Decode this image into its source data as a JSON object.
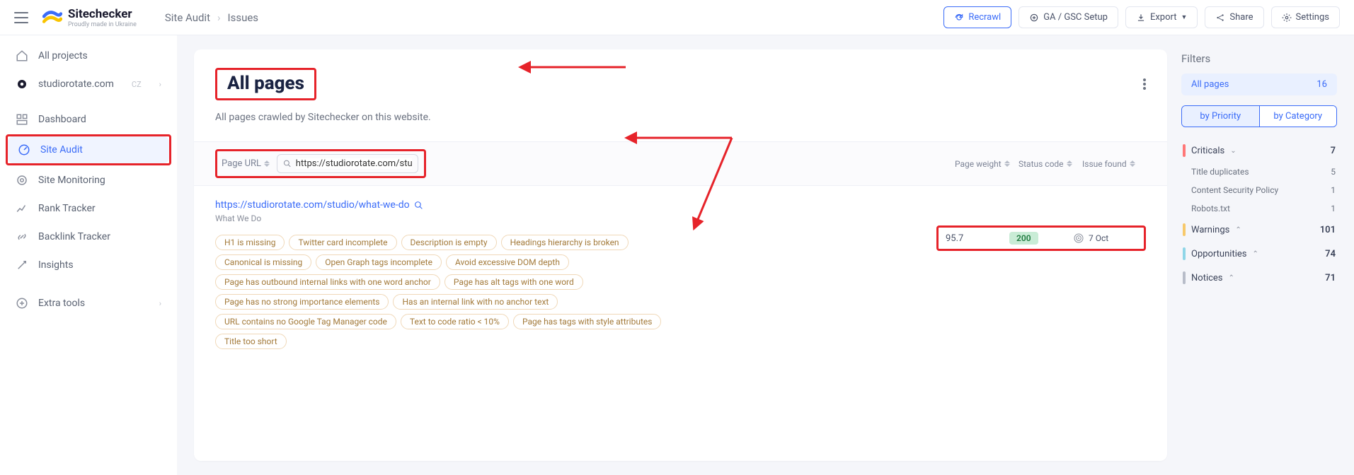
{
  "brand": {
    "title": "Sitechecker",
    "tagline": "Proudly made in Ukraine"
  },
  "breadcrumb": {
    "parent": "Site Audit",
    "current": "Issues"
  },
  "topActions": {
    "recrawl": "Recrawl",
    "gaGsc": "GA / GSC Setup",
    "export": "Export",
    "share": "Share",
    "settings": "Settings"
  },
  "nav": {
    "allProjects": "All projects",
    "project": "studiorotate.com",
    "projectCC": "CZ",
    "dashboard": "Dashboard",
    "siteAudit": "Site Audit",
    "siteMonitoring": "Site Monitoring",
    "rankTracker": "Rank Tracker",
    "backlinkTracker": "Backlink Tracker",
    "insights": "Insights",
    "extraTools": "Extra tools"
  },
  "page": {
    "title": "All pages",
    "subtitle": "All pages crawled by Sitechecker on this website.",
    "columns": {
      "pageUrl": "Page URL",
      "pageWeight": "Page weight",
      "statusCode": "Status code",
      "issueFound": "Issue found"
    },
    "search": {
      "value": "https://studiorotate.com/stu"
    },
    "row": {
      "url": "https://studiorotate.com/studio/what-we-do",
      "title": "What We Do",
      "weight": "95.7",
      "status": "200",
      "issueDate": "7 Oct",
      "tags": [
        "H1 is missing",
        "Twitter card incomplete",
        "Description is empty",
        "Headings hierarchy is broken",
        "Canonical is missing",
        "Open Graph tags incomplete",
        "Avoid excessive DOM depth",
        "Page has outbound internal links with one word anchor",
        "Page has alt tags with one word",
        "Page has no strong importance elements",
        "Has an internal link with no anchor text",
        "URL contains no Google Tag Manager code",
        "Text to code ratio < 10%",
        "Page has tags with style attributes",
        "Title too short"
      ]
    }
  },
  "filters": {
    "title": "Filters",
    "allPages": {
      "label": "All pages",
      "count": "16"
    },
    "byPriority": "by Priority",
    "byCategory": "by Category",
    "criticals": {
      "label": "Criticals",
      "count": "7"
    },
    "criticalsItems": [
      {
        "label": "Title duplicates",
        "count": "5"
      },
      {
        "label": "Content Security Policy",
        "count": "1"
      },
      {
        "label": "Robots.txt",
        "count": "1"
      }
    ],
    "warnings": {
      "label": "Warnings",
      "count": "101"
    },
    "opportunities": {
      "label": "Opportunities",
      "count": "74"
    },
    "notices": {
      "label": "Notices",
      "count": "71"
    }
  }
}
